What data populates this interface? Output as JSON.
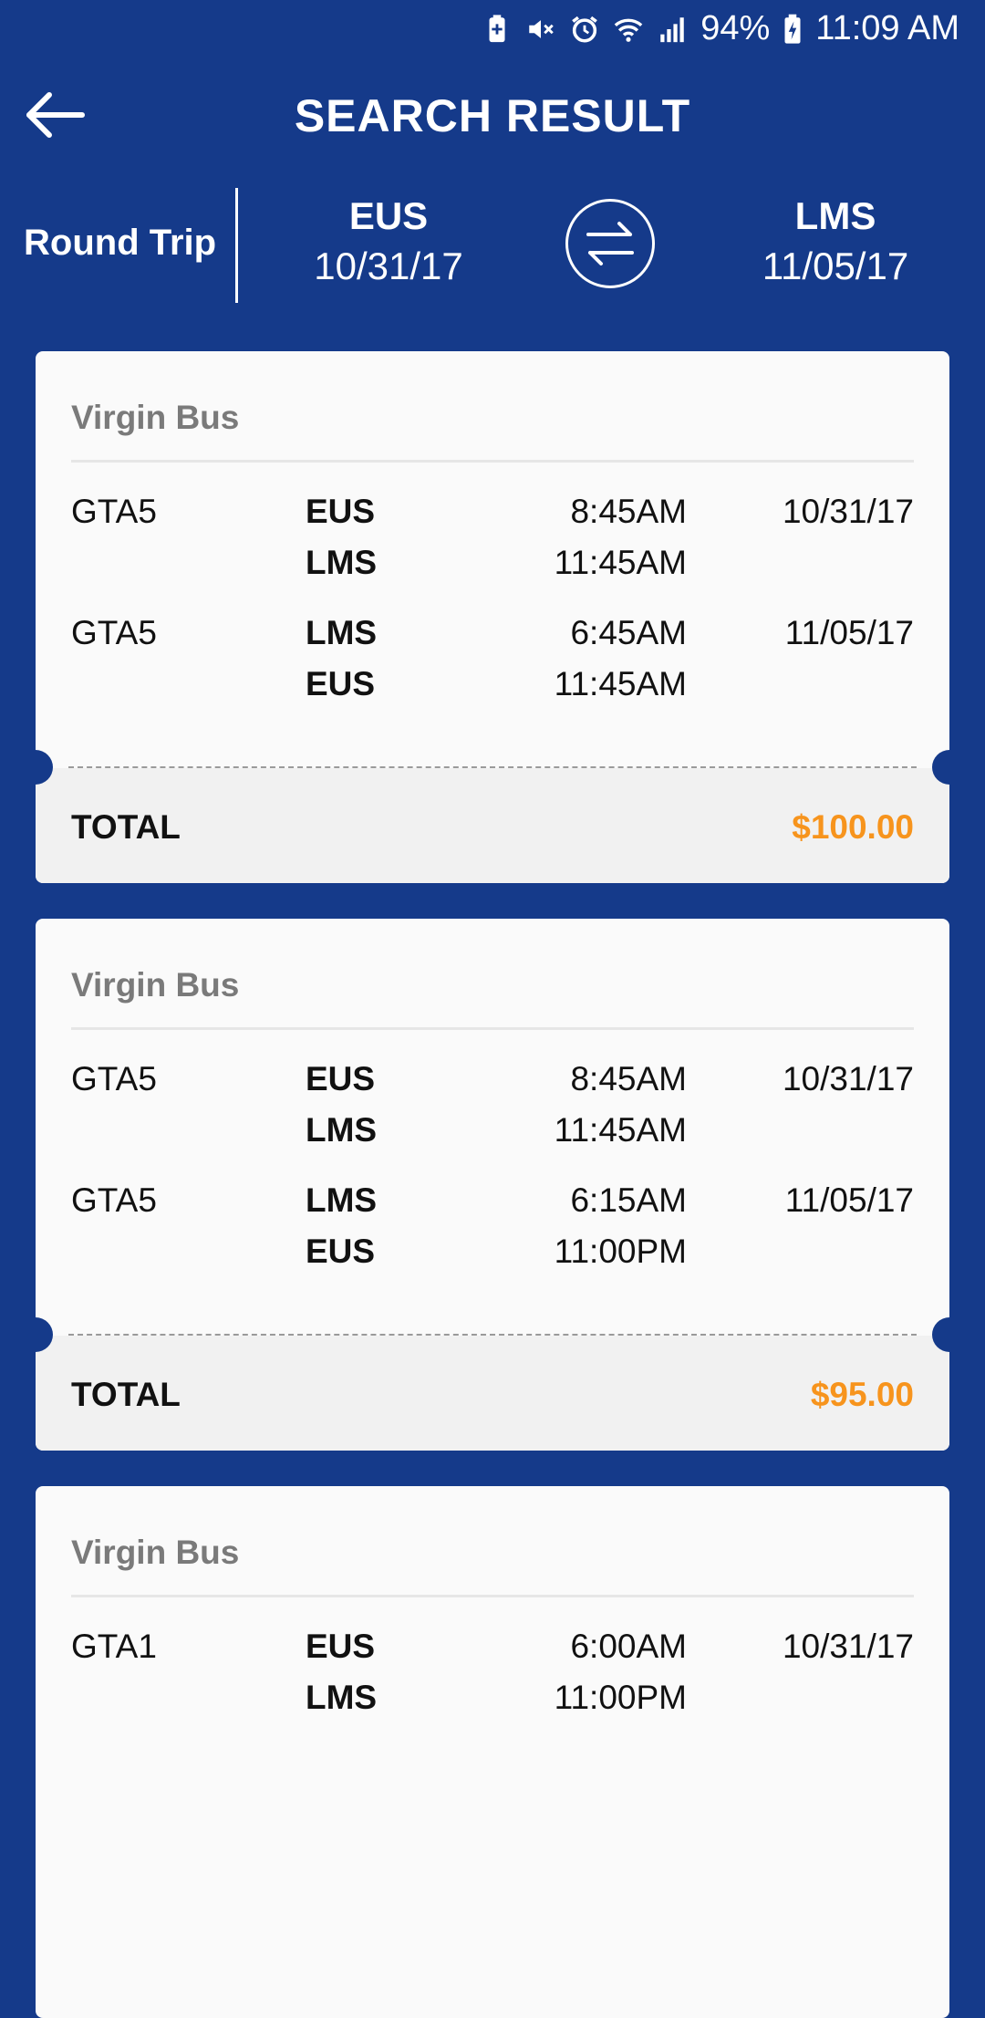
{
  "status_bar": {
    "battery": "94%",
    "time": "11:09 AM",
    "icons": [
      "battery-saver-icon",
      "mute-icon",
      "alarm-icon",
      "wifi-icon",
      "signal-icon",
      "battery-charging-icon"
    ]
  },
  "header": {
    "title": "SEARCH RESULT",
    "back_icon": "back-arrow-icon"
  },
  "trip": {
    "type": "Round Trip",
    "origin": {
      "code": "EUS",
      "date": "10/31/17"
    },
    "destination": {
      "code": "LMS",
      "date": "11/05/17"
    },
    "swap_icon": "swap-arrows-icon"
  },
  "results": [
    {
      "operator": "Virgin Bus",
      "legs": [
        {
          "bus": "GTA5",
          "from": "EUS",
          "to": "LMS",
          "depart": "8:45AM",
          "arrive": "11:45AM",
          "date": "10/31/17"
        },
        {
          "bus": "GTA5",
          "from": "LMS",
          "to": "EUS",
          "depart": "6:45AM",
          "arrive": "11:45AM",
          "date": "11/05/17"
        }
      ],
      "total_label": "TOTAL",
      "total": "$100.00"
    },
    {
      "operator": "Virgin Bus",
      "legs": [
        {
          "bus": "GTA5",
          "from": "EUS",
          "to": "LMS",
          "depart": "8:45AM",
          "arrive": "11:45AM",
          "date": "10/31/17"
        },
        {
          "bus": "GTA5",
          "from": "LMS",
          "to": "EUS",
          "depart": "6:15AM",
          "arrive": "11:00PM",
          "date": "11/05/17"
        }
      ],
      "total_label": "TOTAL",
      "total": "$95.00"
    },
    {
      "operator": "Virgin Bus",
      "legs": [
        {
          "bus": "GTA1",
          "from": "EUS",
          "to": "LMS",
          "depart": "6:00AM",
          "arrive": "11:00PM",
          "date": "10/31/17"
        }
      ]
    }
  ],
  "colors": {
    "background": "#153a8a",
    "card": "#fafafa",
    "footer": "#f1f1f1",
    "price": "#f7941d",
    "operator": "#7a7a7a"
  }
}
